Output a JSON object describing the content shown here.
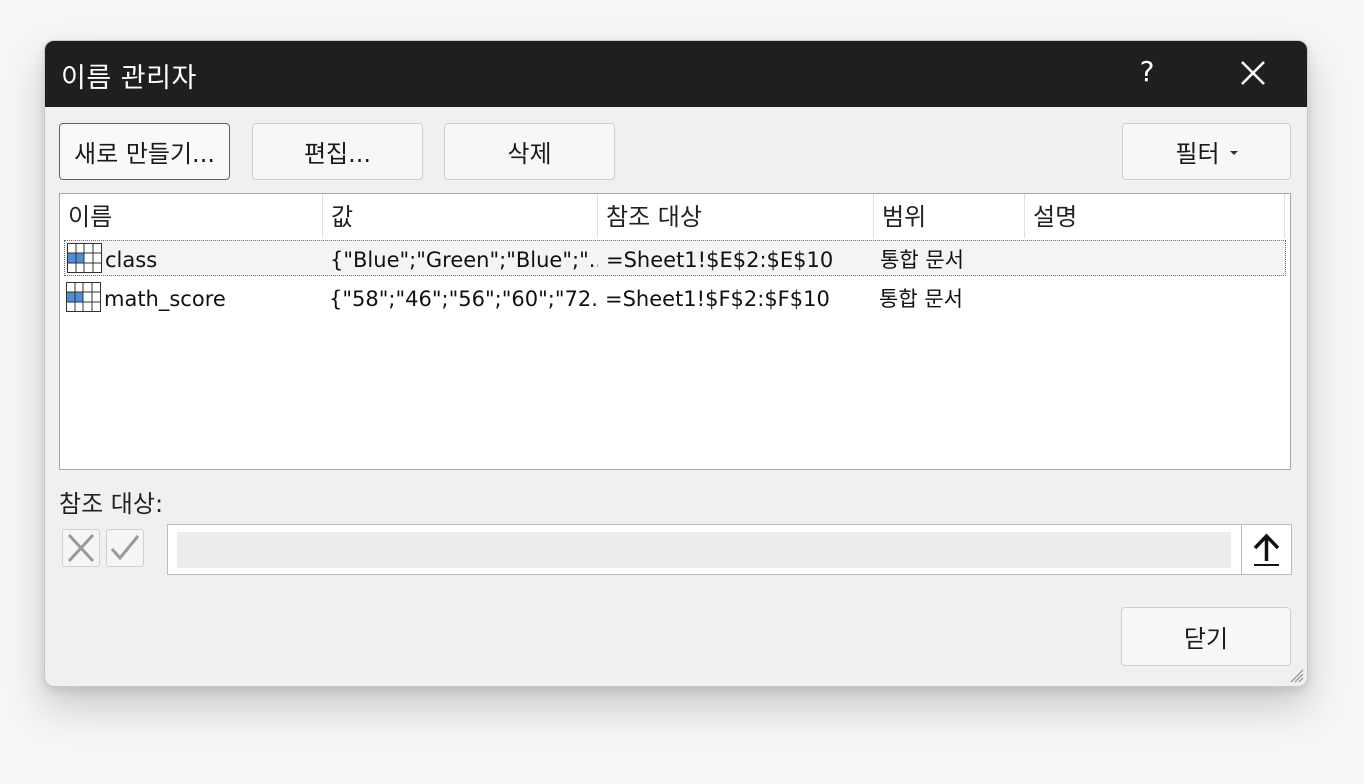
{
  "dialog": {
    "title": "이름 관리자",
    "help_label": "?"
  },
  "toolbar": {
    "new_label": "새로 만들기...",
    "edit_label": "편집...",
    "delete_label": "삭제",
    "filter_label": "필터"
  },
  "list": {
    "columns": [
      "이름",
      "값",
      "참조 대상",
      "범위",
      "설명"
    ],
    "rows": [
      {
        "name": "class",
        "value": "{\"Blue\";\"Green\";\"Blue\";\"...",
        "refers_to": "=Sheet1!$E$2:$E$10",
        "scope": "통합 문서",
        "comment": "",
        "selected": true
      },
      {
        "name": "math_score",
        "value": "{\"58\";\"46\";\"56\";\"60\";\"72...",
        "refers_to": "=Sheet1!$F$2:$F$10",
        "scope": "통합 문서",
        "comment": "",
        "selected": false
      }
    ]
  },
  "refers_to_section": {
    "label": "참조 대상:",
    "value": ""
  },
  "footer": {
    "close_label": "닫기"
  },
  "icons": {
    "close": "close-icon",
    "cancel_edit": "x-icon",
    "confirm_edit": "checkmark-icon",
    "collapse": "arrow-up-icon",
    "name_entry": "range-grid-icon"
  },
  "colors": {
    "titlebar_bg": "#1f1f1f",
    "primary_border": "#2a6fb0",
    "grid_icon_fill": "#4f8fd6"
  }
}
